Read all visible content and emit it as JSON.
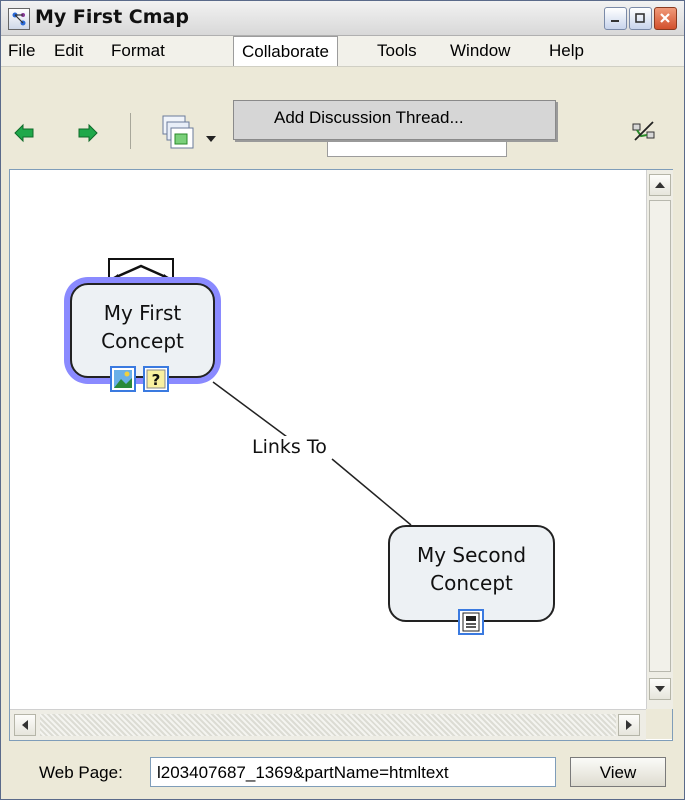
{
  "window": {
    "title": "My First Cmap"
  },
  "menubar": {
    "items": [
      {
        "label": "File"
      },
      {
        "label": "Edit"
      },
      {
        "label": "Format"
      },
      {
        "label": "Collaborate"
      },
      {
        "label": "Tools"
      },
      {
        "label": "Window"
      },
      {
        "label": "Help"
      }
    ],
    "open_menu": "Collaborate"
  },
  "dropdown": {
    "items": [
      {
        "label": "Add Discussion Thread..."
      }
    ]
  },
  "canvas": {
    "concepts": [
      {
        "label_lines": [
          "My First",
          "Concept"
        ],
        "selected": true,
        "resources": [
          "image-resource-icon",
          "help-resource-icon"
        ]
      },
      {
        "label_lines": [
          "My Second",
          "Concept"
        ],
        "selected": false,
        "resources": [
          "document-resource-icon"
        ]
      }
    ],
    "link_phrase": "Links To"
  },
  "statusbar": {
    "label": "Web Page:",
    "value": "l203407687_1369&partName=htmltext",
    "view_button": "View"
  },
  "colors": {
    "selection_halo": "#8a8aff",
    "concept_fill": "#edf1f4",
    "resource_border": "#3a7ae0",
    "nav_arrow": "#1fa84a"
  }
}
